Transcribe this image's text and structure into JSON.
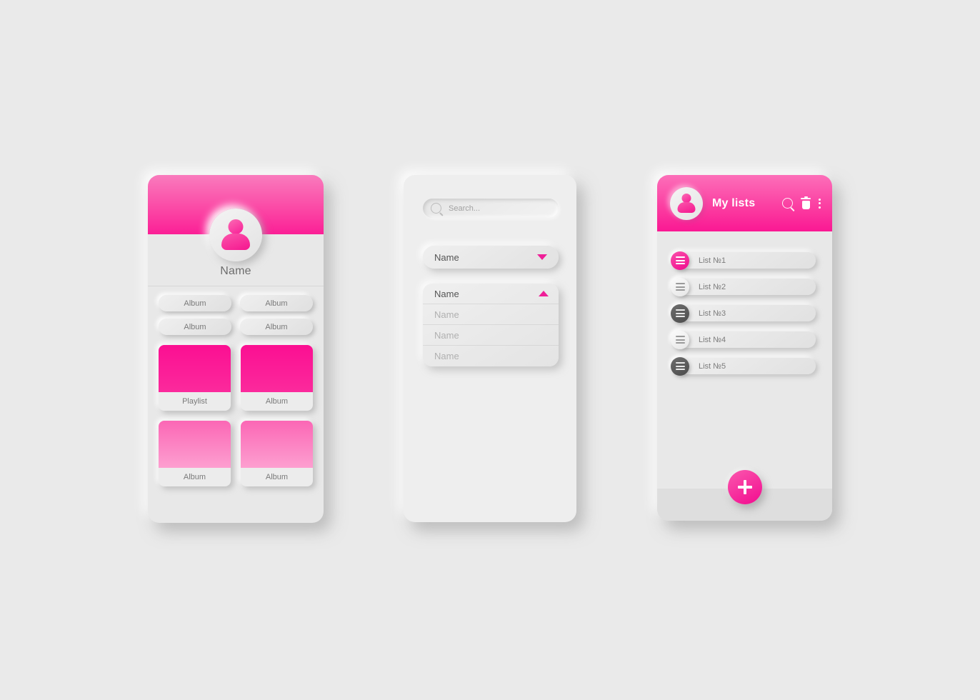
{
  "canvas": {
    "background": "#eaeaea",
    "accent": "#fb1f96"
  },
  "screens": [
    {
      "id": "profile-screen",
      "profile": {
        "name": "Name",
        "avatar_icon": "user-avatar-icon"
      },
      "pills": [
        {
          "label": "Album"
        },
        {
          "label": "Album"
        },
        {
          "label": "Album"
        },
        {
          "label": "Album"
        }
      ],
      "media_cards": [
        {
          "label": "Playlist",
          "thumb": "strong"
        },
        {
          "label": "Album",
          "thumb": "strong"
        },
        {
          "label": "Album",
          "thumb": "soft"
        },
        {
          "label": "Album",
          "thumb": "soft"
        }
      ]
    },
    {
      "id": "search-screen",
      "search": {
        "placeholder": "Search...",
        "value": "",
        "icon": "search-icon"
      },
      "select": {
        "value": "Name",
        "caret": "chevron-down-icon"
      },
      "dropdown": {
        "selected": "Name",
        "caret": "chevron-up-icon",
        "options": [
          {
            "label": "Name"
          },
          {
            "label": "Name"
          },
          {
            "label": "Name"
          }
        ]
      }
    },
    {
      "id": "my-lists-screen",
      "header": {
        "title": "My lists",
        "avatar_icon": "user-avatar-icon",
        "actions": [
          {
            "name": "search-icon"
          },
          {
            "name": "trash-icon"
          },
          {
            "name": "kebab-menu-icon"
          }
        ]
      },
      "lists": [
        {
          "label": "List №1",
          "badge": "pink"
        },
        {
          "label": "List №2",
          "badge": "light"
        },
        {
          "label": "List №3",
          "badge": "dark"
        },
        {
          "label": "List №4",
          "badge": "light"
        },
        {
          "label": "List №5",
          "badge": "dark"
        }
      ],
      "fab": {
        "label": "+",
        "icon": "plus-icon"
      }
    }
  ]
}
